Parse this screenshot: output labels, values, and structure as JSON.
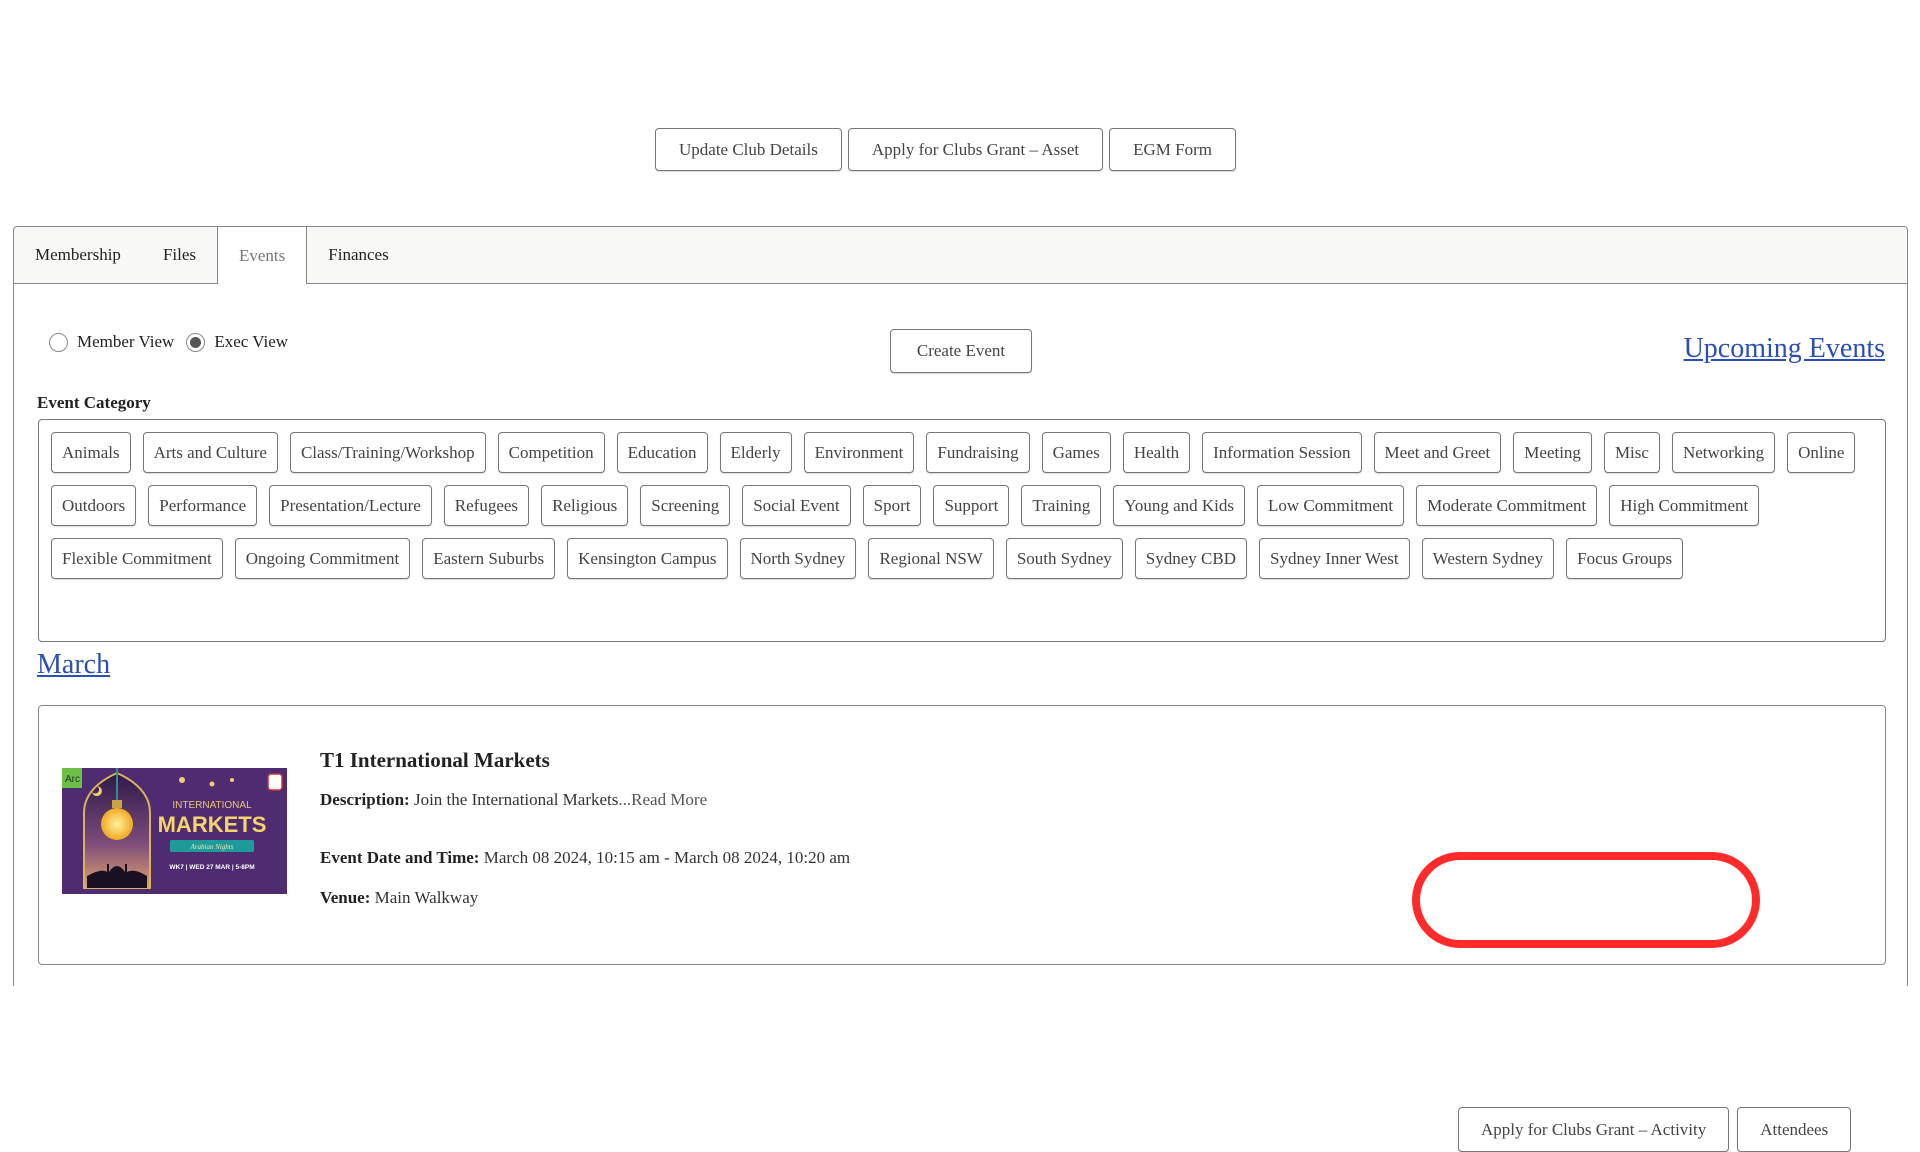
{
  "top_actions": {
    "update_club": "Update Club Details",
    "grant_asset": "Apply for Clubs Grant – Asset",
    "egm_form": "EGM Form"
  },
  "tabs": [
    {
      "label": "Membership",
      "active": false
    },
    {
      "label": "Files",
      "active": false
    },
    {
      "label": "Events",
      "active": true
    },
    {
      "label": "Finances",
      "active": false
    }
  ],
  "view_toggle": {
    "member_view": "Member View",
    "exec_view": "Exec View",
    "selected": "Exec View"
  },
  "create_event": "Create Event",
  "upcoming_events": "Upcoming Events",
  "event_category": {
    "label": "Event Category",
    "chips": [
      "Animals",
      "Arts and Culture",
      "Class/Training/Workshop",
      "Competition",
      "Education",
      "Elderly",
      "Environment",
      "Fundraising",
      "Games",
      "Health",
      "Information Session",
      "Meet and Greet",
      "Meeting",
      "Misc",
      "Networking",
      "Online",
      "Outdoors",
      "Performance",
      "Presentation/Lecture",
      "Refugees",
      "Religious",
      "Screening",
      "Social Event",
      "Sport",
      "Support",
      "Training",
      "Young and Kids",
      "Low Commitment",
      "Moderate Commitment",
      "High Commitment",
      "Flexible Commitment",
      "Ongoing Commitment",
      "Eastern Suburbs",
      "Kensington Campus",
      "North Sydney",
      "Regional NSW",
      "South Sydney",
      "Sydney CBD",
      "Sydney Inner West",
      "Western Sydney",
      "Focus Groups"
    ]
  },
  "month": "March",
  "event": {
    "title": "T1 International Markets",
    "description_label": "Description:",
    "description": "Join the International Markets",
    "read_more": "...Read More",
    "datetime_label": "Event Date and Time:",
    "datetime": "March 08 2024, 10:15 am - March 08 2024, 10:20 am",
    "venue_label": "Venue:",
    "venue": "Main Walkway",
    "image": {
      "brand": "Arc",
      "line1": "INTERNATIONAL",
      "line2": "MARKETS",
      "ribbon": "Arabian Nights",
      "footer": "WK7 | WED 27 MAR | 5-8PM"
    },
    "apply_activity": "Apply for Clubs Grant – Activity",
    "attendees": "Attendees"
  },
  "colors": {
    "link": "#2c4fb5",
    "highlight": "#ff2b2b",
    "tabbar_bg": "#f8f8f6"
  }
}
